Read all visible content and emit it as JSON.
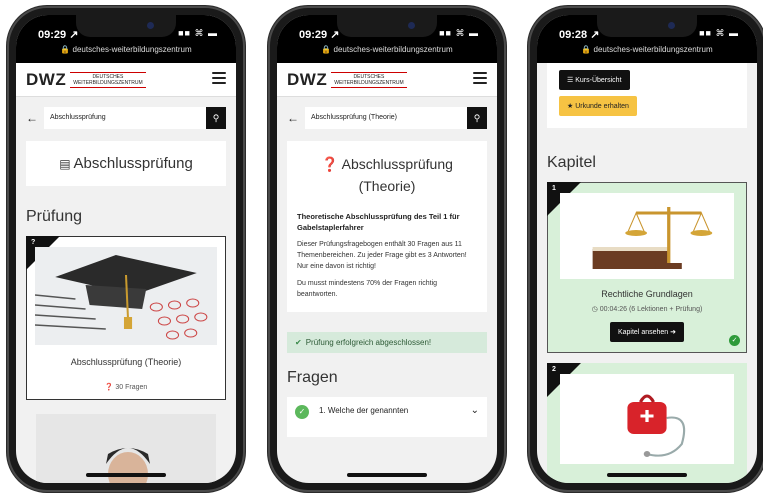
{
  "status": {
    "signal": "■■ ⌘ ▬"
  },
  "phones": [
    {
      "time": "09:29 ↗",
      "url": "🔒 deutsches-weiterbildungszentrum"
    },
    {
      "time": "09:29 ↗",
      "url": "🔒 deutsches-weiterbildungszentrum"
    },
    {
      "time": "09:28 ↗",
      "url": "🔒 deutsches-weiterbildungszentrum"
    }
  ],
  "brand": {
    "logo": "DWZ",
    "tagline_line1": "DEUTSCHES",
    "tagline_line2": "WEITERBILDUNGSZENTRUM"
  },
  "screen1": {
    "search_value": "Abschlussprüfung",
    "title": "Abschlussprüfung",
    "section": "Prüfung",
    "card_name": "Abschlussprüfung (Theorie)",
    "card_meta": "30 Fragen",
    "corner_label": "?"
  },
  "screen2": {
    "search_value": "Abschlussprüfung (Theorie)",
    "title_line1": "Abschlussprüfung",
    "title_line2": "(Theorie)",
    "heading": "Theoretische Abschlussprüfung des Teil 1 für Gabelstaplerfahrer",
    "text1": "Dieser Prüfungsfragebogen enthält 30 Fragen aus 11 Themenbereichen. Zu jeder Frage gibt es 3 Antworten! Nur eine davon ist richtig!",
    "text2": "Du musst mindestens 70% der Fragen richtig beantworten.",
    "success": "Prüfung erfolgreich abgeschlossen!",
    "section": "Fragen",
    "question1": "1. Welche der genannten"
  },
  "screen3": {
    "btn_overview": "Kurs-Übersicht",
    "btn_certificate": "Urkunde erhalten",
    "section": "Kapitel",
    "chapter1": {
      "num": "1",
      "name": "Rechtliche Grundlagen",
      "meta": "00:04:26 (6 Lektionen + Prüfung)",
      "button": "Kapitel ansehen"
    },
    "chapter2": {
      "num": "2"
    }
  },
  "colors": {
    "success_bg": "#d6eadb",
    "chapter_bg": "#d8f0d9",
    "yellow": "#f6c343",
    "dark": "#111111"
  }
}
